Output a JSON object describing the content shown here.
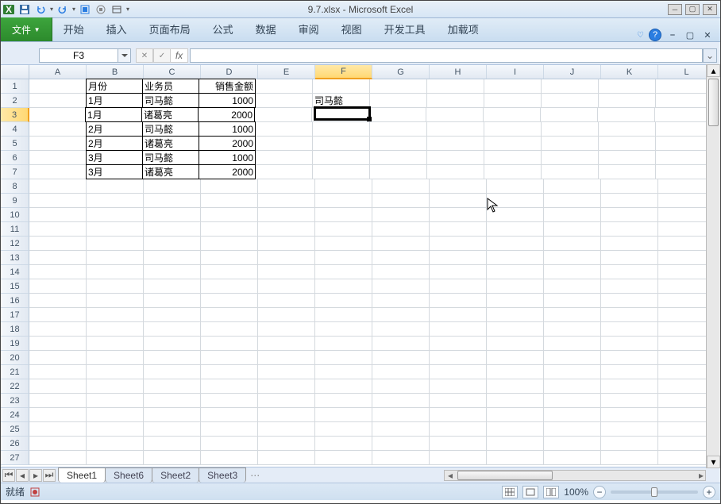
{
  "title": "9.7.xlsx - Microsoft Excel",
  "ribbon": {
    "file": "文件",
    "tabs": [
      "开始",
      "插入",
      "页面布局",
      "公式",
      "数据",
      "审阅",
      "视图",
      "开发工具",
      "加载项"
    ]
  },
  "namebox": "F3",
  "columns": [
    "A",
    "B",
    "C",
    "D",
    "E",
    "F",
    "G",
    "H",
    "I",
    "J",
    "K",
    "L"
  ],
  "selected_col_idx": 5,
  "selected_row_idx": 2,
  "rowcount": 27,
  "data": {
    "B1": "月份",
    "C1": "业务员",
    "D1": "销售金额",
    "B2": "1月",
    "C2": "司马懿",
    "D2": "1000",
    "B3": "1月",
    "C3": "诸葛亮",
    "D3": "2000",
    "B4": "2月",
    "C4": "司马懿",
    "D4": "1000",
    "B5": "2月",
    "C5": "诸葛亮",
    "D5": "2000",
    "B6": "3月",
    "C6": "司马懿",
    "D6": "1000",
    "B7": "3月",
    "C7": "诸葛亮",
    "D7": "2000",
    "F2": "司马懿"
  },
  "numeric_cols": [
    "D"
  ],
  "bordered_range": {
    "r1": 1,
    "r2": 7,
    "c1": "B",
    "c2": "D"
  },
  "sheets": {
    "active": "Sheet1",
    "list": [
      "Sheet1",
      "Sheet6",
      "Sheet2",
      "Sheet3"
    ]
  },
  "status": {
    "ready": "就绪",
    "rec": "",
    "zoom": "100%"
  },
  "active_cell": "F3"
}
